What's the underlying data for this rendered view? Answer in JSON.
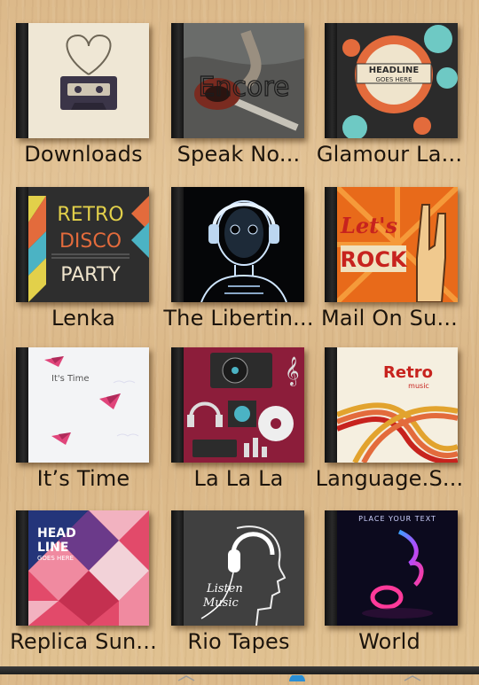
{
  "albums": [
    {
      "title": "Downloads"
    },
    {
      "title": "Speak No...",
      "art_text": "Encore"
    },
    {
      "title": "Glamour La...",
      "art_text_1": "HEADLINE",
      "art_text_2": "GOES HERE"
    },
    {
      "title": "Lenka",
      "art_text_1": "RETRO",
      "art_text_2": "DISCO",
      "art_text_3": "PARTY"
    },
    {
      "title": "The Libertin..."
    },
    {
      "title": "Mail On Su...",
      "art_text_1": "Let's",
      "art_text_2": "ROCK"
    },
    {
      "title": "It’s Time",
      "art_text": "It's Time"
    },
    {
      "title": "La La La"
    },
    {
      "title": "Language.S...",
      "art_text_1": "Retro",
      "art_text_2": "music"
    },
    {
      "title": "Replica Sun...",
      "art_text_1": "HEAD",
      "art_text_2": "LINE",
      "art_text_3": "GOES HERE"
    },
    {
      "title": "Rio Tapes",
      "art_text_1": "Listen",
      "art_text_2": "Music"
    },
    {
      "title": "World",
      "art_text": "PLACE YOUR TEXT"
    }
  ],
  "colors": {
    "wood": "#e0c192",
    "label_text": "#1c140c",
    "nav_bar": "#2a2a2a",
    "nav_accent": "#2a8fd6"
  },
  "nav": {
    "icons": [
      "back-icon",
      "home-icon",
      "recent-apps-icon"
    ]
  }
}
